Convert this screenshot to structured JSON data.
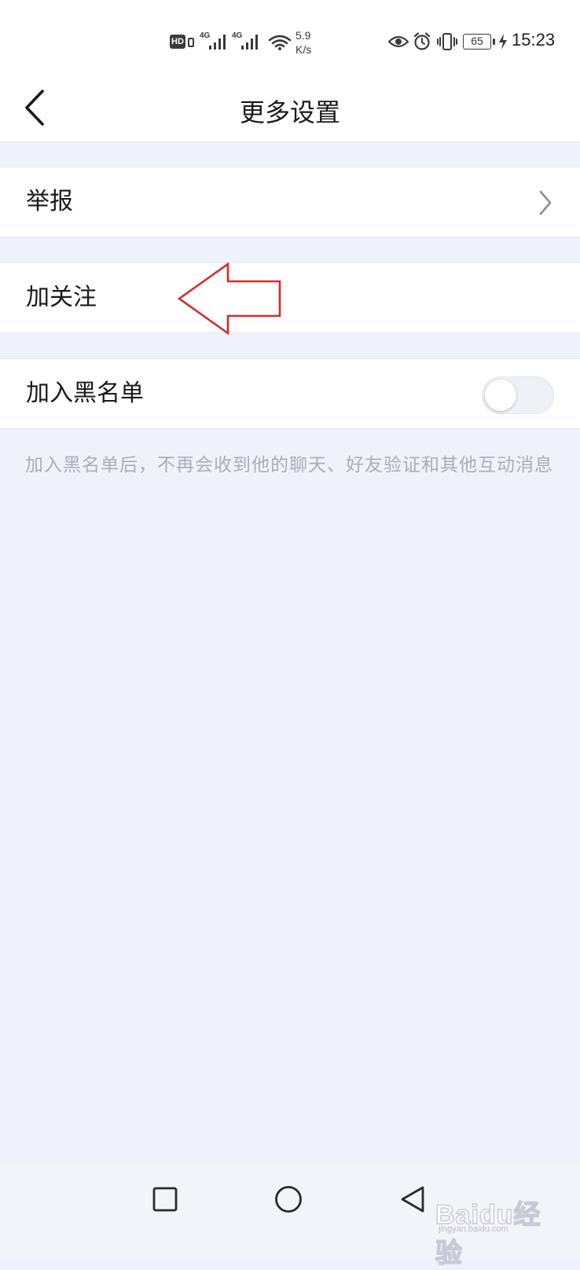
{
  "status_bar": {
    "hd_badge": "HD",
    "signal_1_tag": "4G",
    "signal_2_tag": "4G",
    "speed_value": "5.9",
    "speed_unit": "K/s",
    "battery": "65",
    "time": "15:23"
  },
  "header": {
    "title": "更多设置"
  },
  "settings": {
    "report_label": "举报",
    "follow_label": "加关注",
    "blacklist_label": "加入黑名单",
    "blacklist_enabled": false,
    "blacklist_hint": "加入黑名单后，不再会收到他的聊天、好友验证和其他互动消息"
  },
  "annotation": {
    "arrow_color": "#d42b2b"
  },
  "watermark": {
    "brand": "Baidu经验",
    "url": "jingyan.baidu.com"
  }
}
